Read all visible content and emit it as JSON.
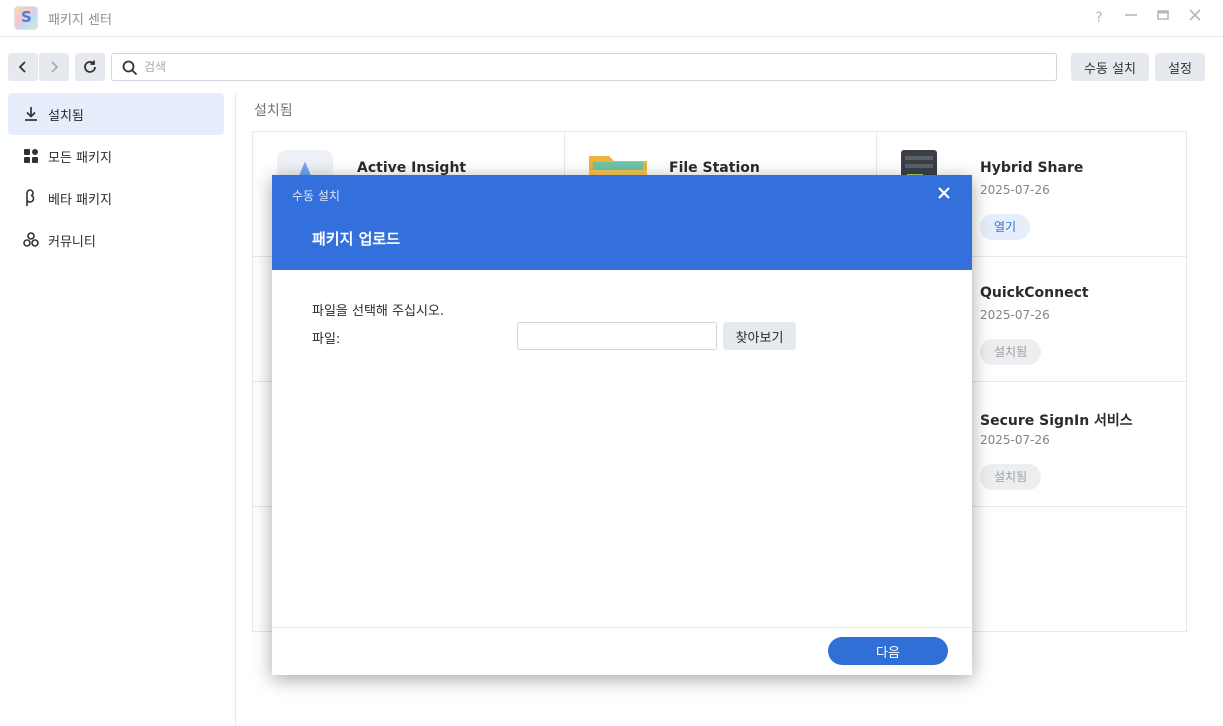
{
  "window": {
    "title": "패키지 센터"
  },
  "toolbar": {
    "search_placeholder": "검색",
    "manual_install": "수동 설치",
    "settings": "설정"
  },
  "sidebar": {
    "items": [
      {
        "label": "설치됨",
        "icon": "download-icon",
        "active": true
      },
      {
        "label": "모든 패키지",
        "icon": "grid-icon",
        "active": false
      },
      {
        "label": "베타 패키지",
        "icon": "beta-icon",
        "active": false
      },
      {
        "label": "커뮤니티",
        "icon": "community-icon",
        "active": false
      }
    ]
  },
  "main": {
    "section_title": "설치됨",
    "packages": [
      {
        "name": "Active Insight",
        "icon": "active-insight-icon"
      },
      {
        "name": "File Station",
        "icon": "folder-icon"
      },
      {
        "name": "Hybrid Share",
        "date": "2025-07-26",
        "button": "열기",
        "icon": "server-icon"
      },
      {
        "name": "QuickConnect",
        "date": "2025-07-26",
        "button": "설치됨"
      },
      {
        "name": "Secure SignIn 서비스",
        "date": "2025-07-26",
        "button": "설치됨"
      }
    ]
  },
  "dialog": {
    "caption": "수동 설치",
    "title": "패키지 업로드",
    "description": "파일을 선택해 주십시오.",
    "file_label": "파일:",
    "file_value": "",
    "browse": "찾아보기",
    "next": "다음"
  },
  "colors": {
    "accent": "#3370db",
    "button_blue": "#2f6fd6",
    "sidebar_active": "#e6eefb"
  }
}
